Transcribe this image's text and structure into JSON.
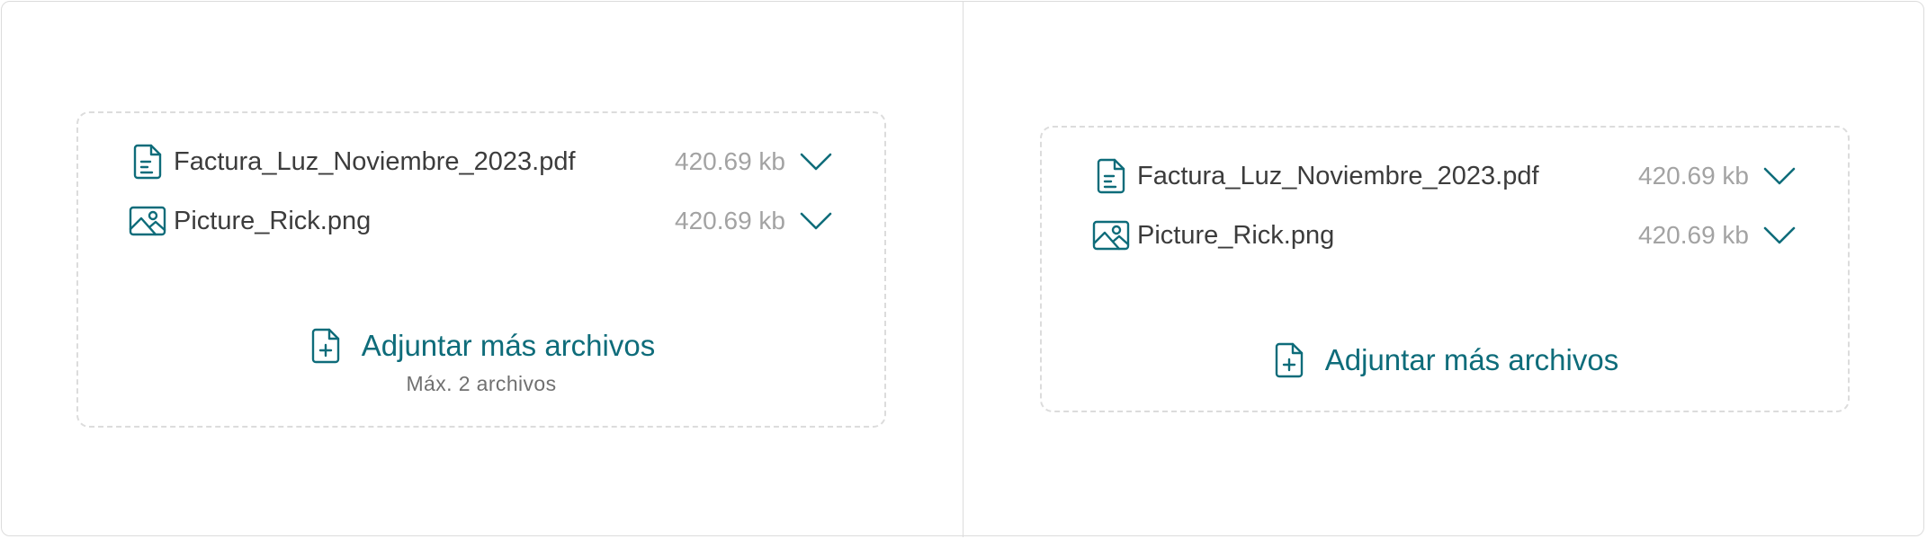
{
  "accent_color": "#0e6c7a",
  "panels": [
    {
      "files": [
        {
          "icon": "document-icon",
          "name": "Factura_Luz_Noviembre_2023.pdf",
          "size": "420.69 kb"
        },
        {
          "icon": "image-icon",
          "name": "Picture_Rick.png",
          "size": "420.69 kb"
        }
      ],
      "attach_label": "Adjuntar más archivos",
      "max_note": "Máx. 2 archivos"
    },
    {
      "files": [
        {
          "icon": "document-icon",
          "name": "Factura_Luz_Noviembre_2023.pdf",
          "size": "420.69 kb"
        },
        {
          "icon": "image-icon",
          "name": "Picture_Rick.png",
          "size": "420.69 kb"
        }
      ],
      "attach_label": "Adjuntar más archivos"
    }
  ]
}
